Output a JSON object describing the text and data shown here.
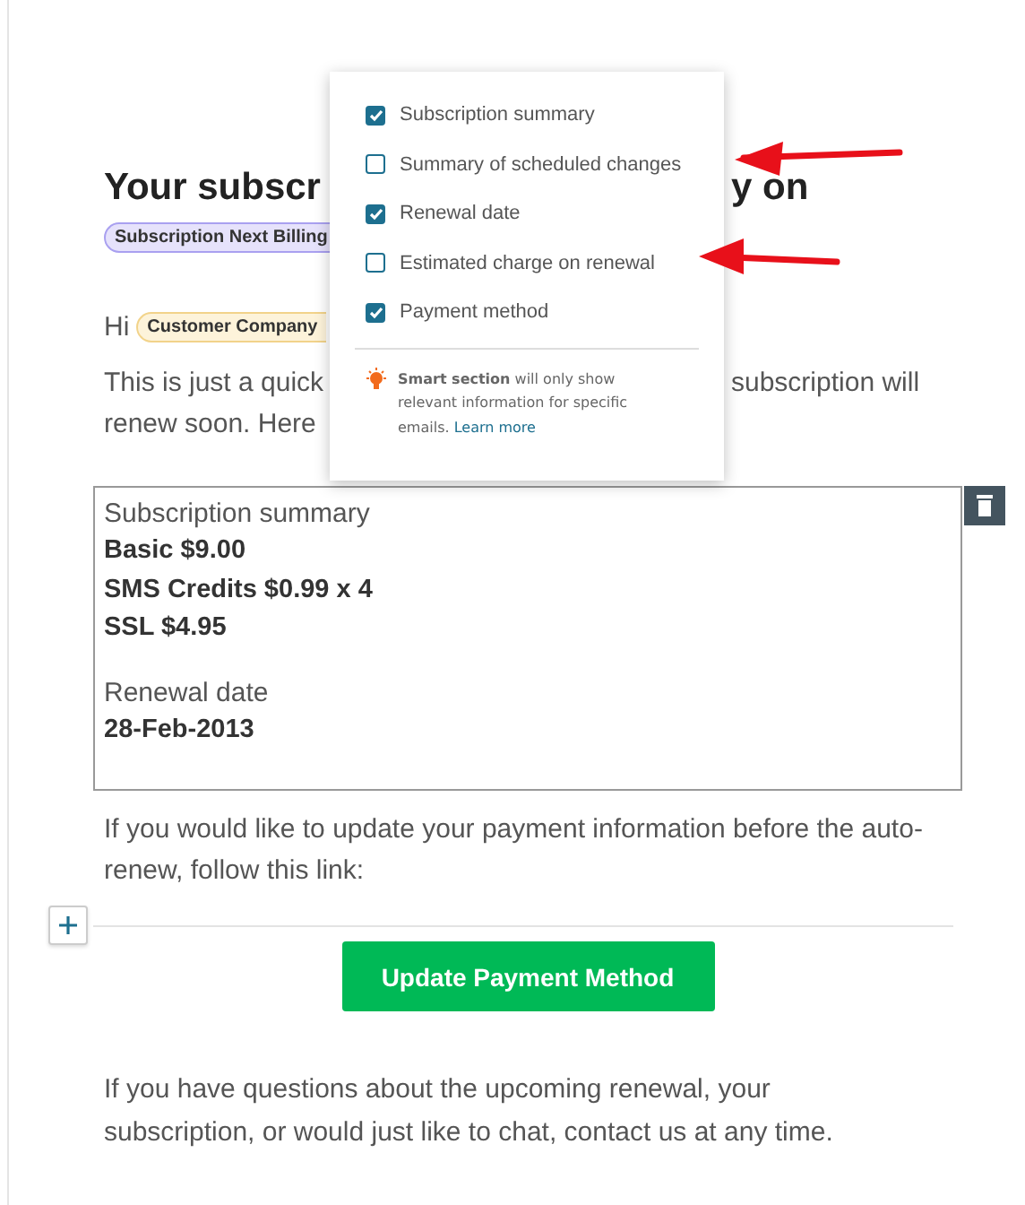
{
  "email": {
    "heading": {
      "left": "Your subscr",
      "right": "y on"
    },
    "tag": "Subscription Next Billing",
    "greeting": "Hi",
    "customer_tag": "Customer Company",
    "intro_lines": [
      {
        "left": "This is just a quick",
        "right": "subscription will"
      },
      {
        "left": "renew soon. Here"
      }
    ],
    "section": {
      "blocks": [
        {
          "title": "Subscription summary",
          "lines": [
            "Basic $9.00",
            "SMS Credits $0.99 x 4",
            "SSL $4.95"
          ]
        },
        {
          "title": "Renewal date",
          "lines": [
            "28-Feb-2013"
          ]
        }
      ]
    },
    "payment_text": "If you would like to update your payment information before the auto-renew, follow this link:",
    "button": "Update Payment Method",
    "closing": "If you have questions about the upcoming renewal, your subscription, or would just like to chat, contact us at any time."
  },
  "popup": {
    "options": [
      {
        "label": "Subscription summary",
        "checked": true
      },
      {
        "label": "Summary of scheduled changes",
        "checked": false
      },
      {
        "label": "Renewal date",
        "checked": true
      },
      {
        "label": "Estimated charge on renewal",
        "checked": false
      },
      {
        "label": "Payment method",
        "checked": true
      }
    ],
    "note": "**Smart section** will only show relevant information for specific emails.",
    "link": "Learn more"
  }
}
